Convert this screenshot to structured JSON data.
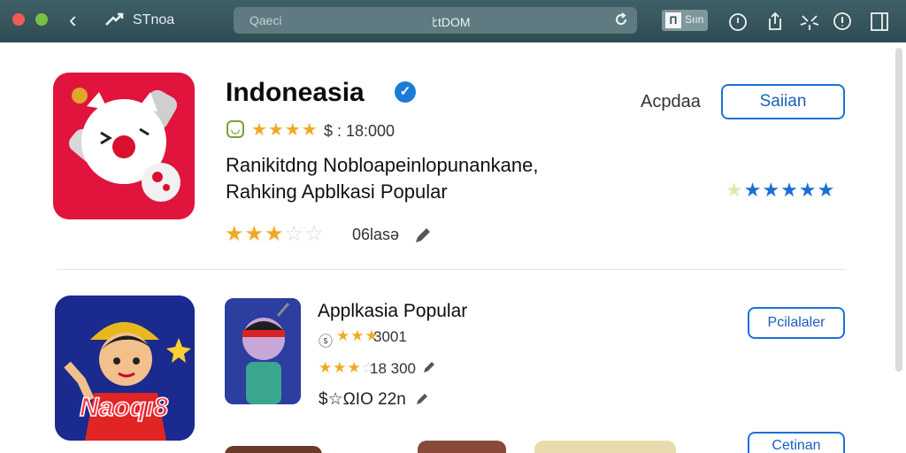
{
  "titlebar": {
    "app_name": "STnoa",
    "search_placeholder": "Qaeci",
    "address_text": "ﾋtDOM",
    "tab_box_label": "Π",
    "tab_label": "Sıın",
    "icons": [
      "back-icon",
      "logo-icon",
      "reload-icon",
      "info-icon",
      "share-icon",
      "sparkle-icon",
      "info-icon",
      "sidebar-icon"
    ]
  },
  "featured": {
    "title": "Indoneasia",
    "rating_line": "$ : 18:000",
    "rating_stars": 4.5,
    "description_line1": "Ranikitdng  Nobloapeinlopunankane,",
    "description_line2": "Rahking Apblkasi Popular",
    "user_rating": 2.5,
    "user_rating_label": "06lasə",
    "side_label": "Acpdaa",
    "action_button": "Saiian",
    "side_rating_stars": 5,
    "colors": {
      "icon_bg": "#e0143c",
      "accent": "#1b72d8",
      "star": "#f0a926"
    }
  },
  "list": [
    {
      "title": "Applkasia Popular",
      "rating_line": "3001",
      "line2": "18 300",
      "line3": "$☆ΩΙΟ 22n",
      "action_button": "Pcilalaler",
      "colors": {
        "icon_bg": "#1b2a8e",
        "thumb_bg": "#2a3f9a"
      }
    },
    {
      "title": "",
      "action_button": "Cetinan"
    }
  ]
}
